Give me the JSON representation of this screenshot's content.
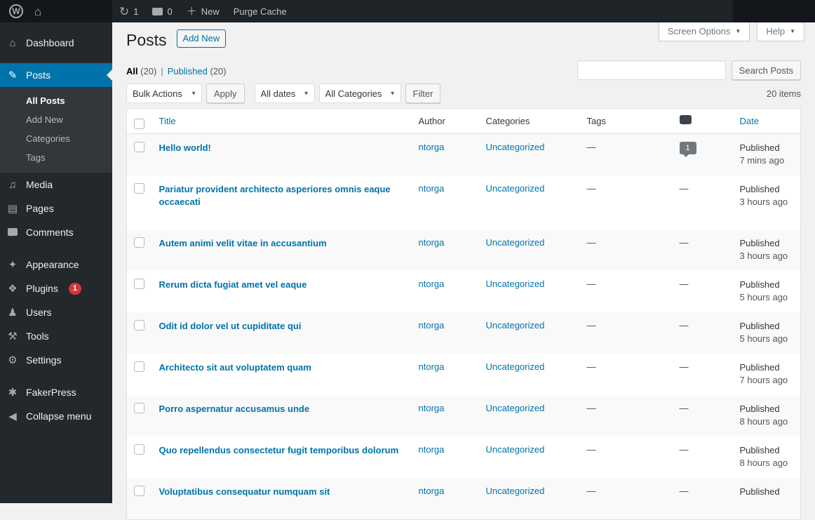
{
  "colors": {
    "accent": "#0073aa",
    "admin_bar_bg": "#1d2327",
    "sidebar_bg": "#23282d",
    "badge_red": "#d63638",
    "comment_bubble_gray": "#72777c"
  },
  "admin_bar": {
    "updates_count": "1",
    "comments_count": "0",
    "new_label": "New",
    "purge_cache_label": "Purge Cache"
  },
  "sidebar": {
    "groups": [
      {
        "items": [
          {
            "id": "dashboard",
            "label": "Dashboard",
            "icon": "dashboard-icon"
          }
        ]
      },
      {
        "items": [
          {
            "id": "posts",
            "label": "Posts",
            "icon": "pushpin-icon",
            "active": true,
            "submenu": [
              {
                "id": "all-posts",
                "label": "All Posts",
                "current": true
              },
              {
                "id": "add-new",
                "label": "Add New"
              },
              {
                "id": "categories",
                "label": "Categories"
              },
              {
                "id": "tags",
                "label": "Tags"
              }
            ]
          },
          {
            "id": "media",
            "label": "Media",
            "icon": "media-icon"
          },
          {
            "id": "pages",
            "label": "Pages",
            "icon": "pages-icon"
          },
          {
            "id": "comments",
            "label": "Comments",
            "icon": "comments-icon"
          }
        ]
      },
      {
        "items": [
          {
            "id": "appearance",
            "label": "Appearance",
            "icon": "appearance-icon"
          },
          {
            "id": "plugins",
            "label": "Plugins",
            "icon": "plugins-icon",
            "badge": "1"
          },
          {
            "id": "users",
            "label": "Users",
            "icon": "users-icon"
          },
          {
            "id": "tools",
            "label": "Tools",
            "icon": "tools-icon"
          },
          {
            "id": "settings",
            "label": "Settings",
            "icon": "settings-icon"
          }
        ]
      },
      {
        "items": [
          {
            "id": "fakerpress",
            "label": "FakerPress",
            "icon": "fakerpress-icon"
          },
          {
            "id": "collapse-menu",
            "label": "Collapse menu",
            "icon": "collapse-icon"
          }
        ]
      }
    ]
  },
  "page": {
    "title": "Posts",
    "add_new_label": "Add New",
    "screen_options_label": "Screen Options",
    "help_label": "Help"
  },
  "views": {
    "all_label": "All",
    "all_count": "(20)",
    "published_label": "Published",
    "published_count": "(20)"
  },
  "toolbar": {
    "bulk_actions": "Bulk Actions",
    "apply_label": "Apply",
    "dates_filter": "All dates",
    "categories_filter": "All Categories",
    "filter_label": "Filter",
    "items_count": "20 items",
    "search_value": "",
    "search_button_label": "Search Posts"
  },
  "table": {
    "headers": {
      "title": "Title",
      "author": "Author",
      "categories": "Categories",
      "tags": "Tags",
      "comments_icon": "comments-icon",
      "date": "Date"
    },
    "rows": [
      {
        "title": "Hello world!",
        "author": "ntorga",
        "categories": "Uncategorized",
        "tags": "—",
        "comments": "1",
        "status": "Published",
        "date": "7 mins ago"
      },
      {
        "title": "Pariatur provident architecto asperiores omnis eaque occaecati",
        "author": "ntorga",
        "categories": "Uncategorized",
        "tags": "—",
        "comments": "—",
        "status": "Published",
        "date": "3 hours ago"
      },
      {
        "title": "Autem animi velit vitae in accusantium",
        "author": "ntorga",
        "categories": "Uncategorized",
        "tags": "—",
        "comments": "—",
        "status": "Published",
        "date": "3 hours ago"
      },
      {
        "title": "Rerum dicta fugiat amet vel eaque",
        "author": "ntorga",
        "categories": "Uncategorized",
        "tags": "—",
        "comments": "—",
        "status": "Published",
        "date": "5 hours ago"
      },
      {
        "title": "Odit id dolor vel ut cupiditate qui",
        "author": "ntorga",
        "categories": "Uncategorized",
        "tags": "—",
        "comments": "—",
        "status": "Published",
        "date": "5 hours ago"
      },
      {
        "title": "Architecto sit aut voluptatem quam",
        "author": "ntorga",
        "categories": "Uncategorized",
        "tags": "—",
        "comments": "—",
        "status": "Published",
        "date": "7 hours ago"
      },
      {
        "title": "Porro aspernatur accusamus unde",
        "author": "ntorga",
        "categories": "Uncategorized",
        "tags": "—",
        "comments": "—",
        "status": "Published",
        "date": "8 hours ago"
      },
      {
        "title": "Quo repellendus consectetur fugit temporibus dolorum",
        "author": "ntorga",
        "categories": "Uncategorized",
        "tags": "—",
        "comments": "—",
        "status": "Published",
        "date": "8 hours ago"
      },
      {
        "title": "Voluptatibus consequatur numquam sit",
        "author": "ntorga",
        "categories": "Uncategorized",
        "tags": "—",
        "comments": "—",
        "status": "Published",
        "date": ""
      }
    ]
  }
}
